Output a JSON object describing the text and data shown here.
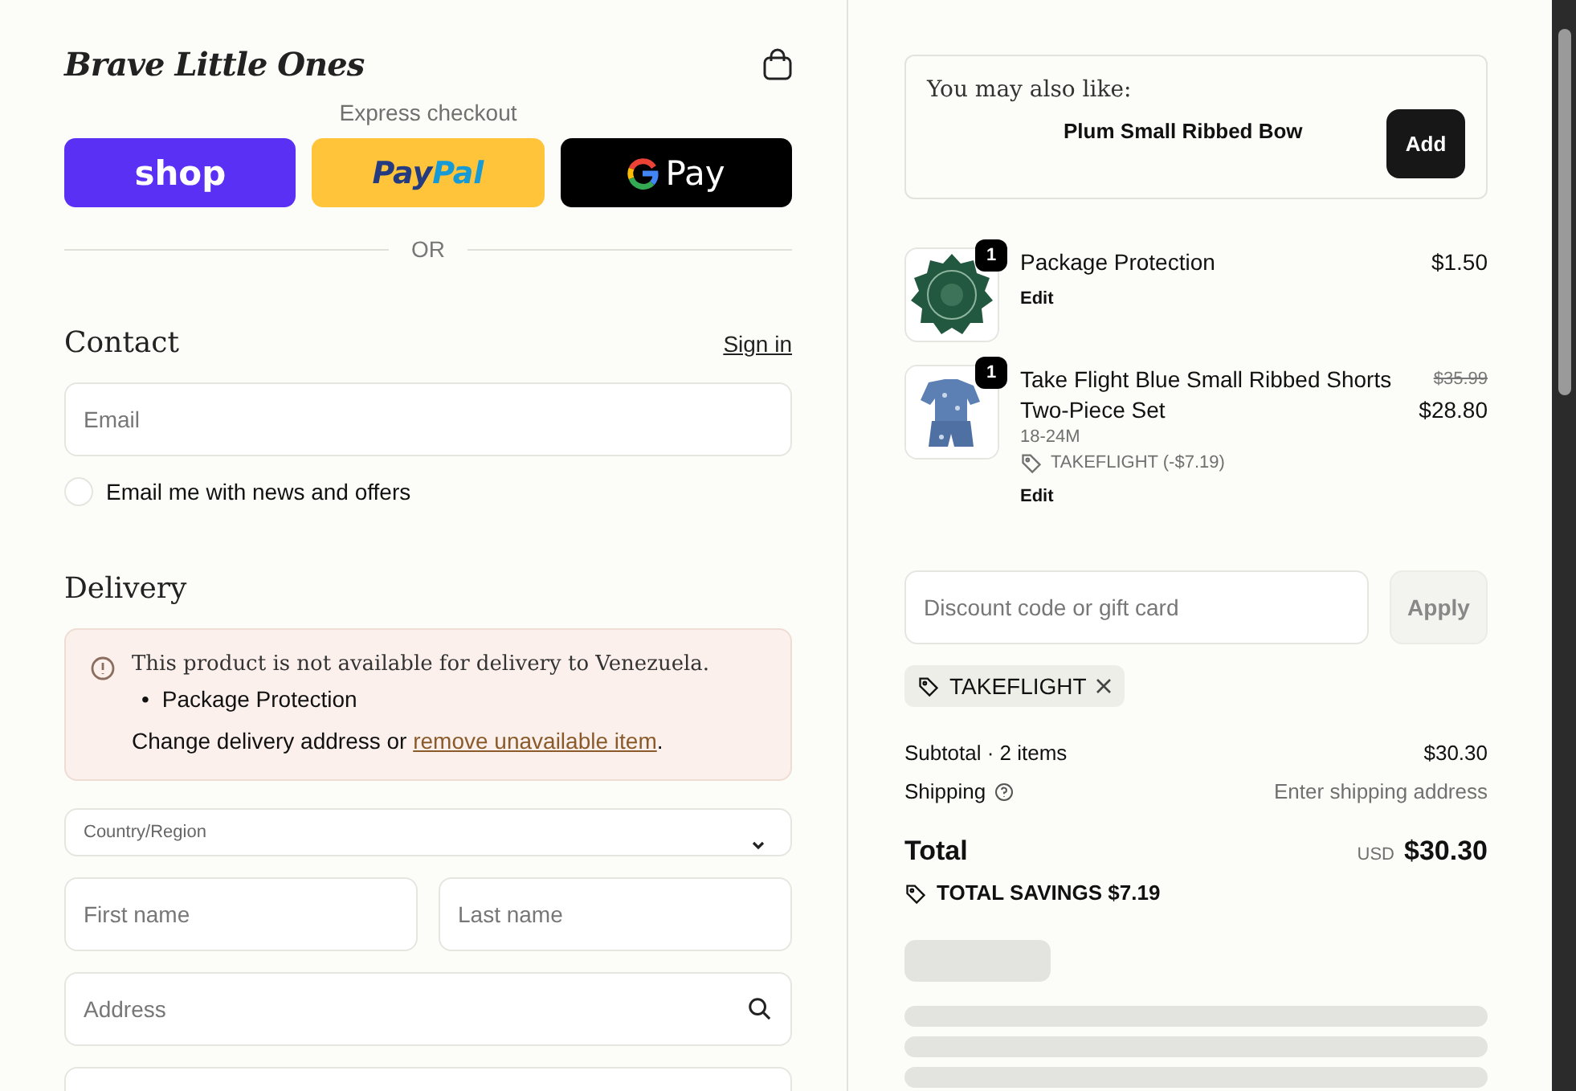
{
  "brand": "Brave Little Ones",
  "express": {
    "label": "Express checkout",
    "shop": "shop",
    "paypal": [
      "Pay",
      "Pal"
    ],
    "gpay": "Pay",
    "divider": "OR"
  },
  "contact": {
    "heading": "Contact",
    "sign_in": "Sign in",
    "email": {
      "placeholder": "Email"
    },
    "newsletter": {
      "label": "Email me with news and offers",
      "checked": false
    }
  },
  "delivery": {
    "heading": "Delivery",
    "alert": {
      "message": "This product is not available for delivery to Venezuela.",
      "bullet": "•",
      "items": [
        "Package Protection"
      ],
      "prefix": "Change delivery address or ",
      "link": "remove unavailable item",
      "suffix": "."
    },
    "country": {
      "label": "Country/Region"
    },
    "first_name": {
      "placeholder": "First name"
    },
    "last_name": {
      "placeholder": "Last name"
    },
    "address": {
      "placeholder": "Address"
    }
  },
  "upsell": {
    "heading": "You may also like:",
    "product": "Plum Small Ribbed Bow",
    "button": "Add"
  },
  "items": [
    {
      "kind": "badge",
      "quantity": "1",
      "name": "Package Protection",
      "price": "$1.50",
      "edit": "Edit"
    },
    {
      "kind": "clothing",
      "quantity": "1",
      "name": "Take Flight Blue Small Ribbed Shorts Two-Piece Set",
      "variant": "18-24M",
      "discount": "TAKEFLIGHT (-$7.19)",
      "old_price": "$35.99",
      "price": "$28.80",
      "edit": "Edit"
    }
  ],
  "discount": {
    "placeholder": "Discount code or gift card",
    "button": "Apply",
    "code": "TAKEFLIGHT"
  },
  "summary": {
    "subtotal_label": "Subtotal · 2 items",
    "subtotal": "$30.30",
    "shipping_label": "Shipping",
    "shipping": "Enter shipping address",
    "total_label": "Total",
    "currency": "USD",
    "total": "$30.30",
    "savings": "TOTAL SAVINGS $7.19"
  }
}
